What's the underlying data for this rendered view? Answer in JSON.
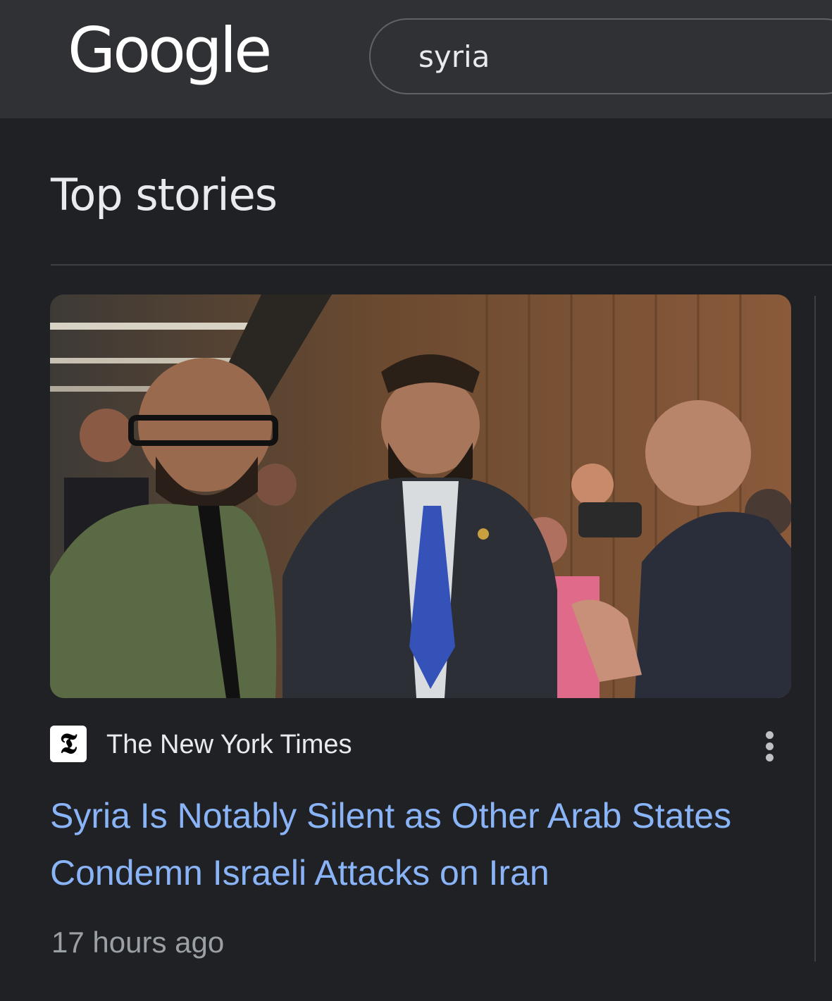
{
  "header": {
    "logo_text": "Google",
    "search_query": "syria"
  },
  "section": {
    "title": "Top stories"
  },
  "story": {
    "source": "The New York Times",
    "source_logo_glyph": "𝕿",
    "headline": "Syria Is Notably Silent as Other Arab States Condemn Israeli Attacks on Iran",
    "time": "17 hours ago",
    "more_icon": "more-vert-icon"
  },
  "colors": {
    "background": "#202124",
    "header_background": "#303134",
    "headline_link": "#8ab4f8",
    "secondary_text": "#9aa0a6"
  }
}
